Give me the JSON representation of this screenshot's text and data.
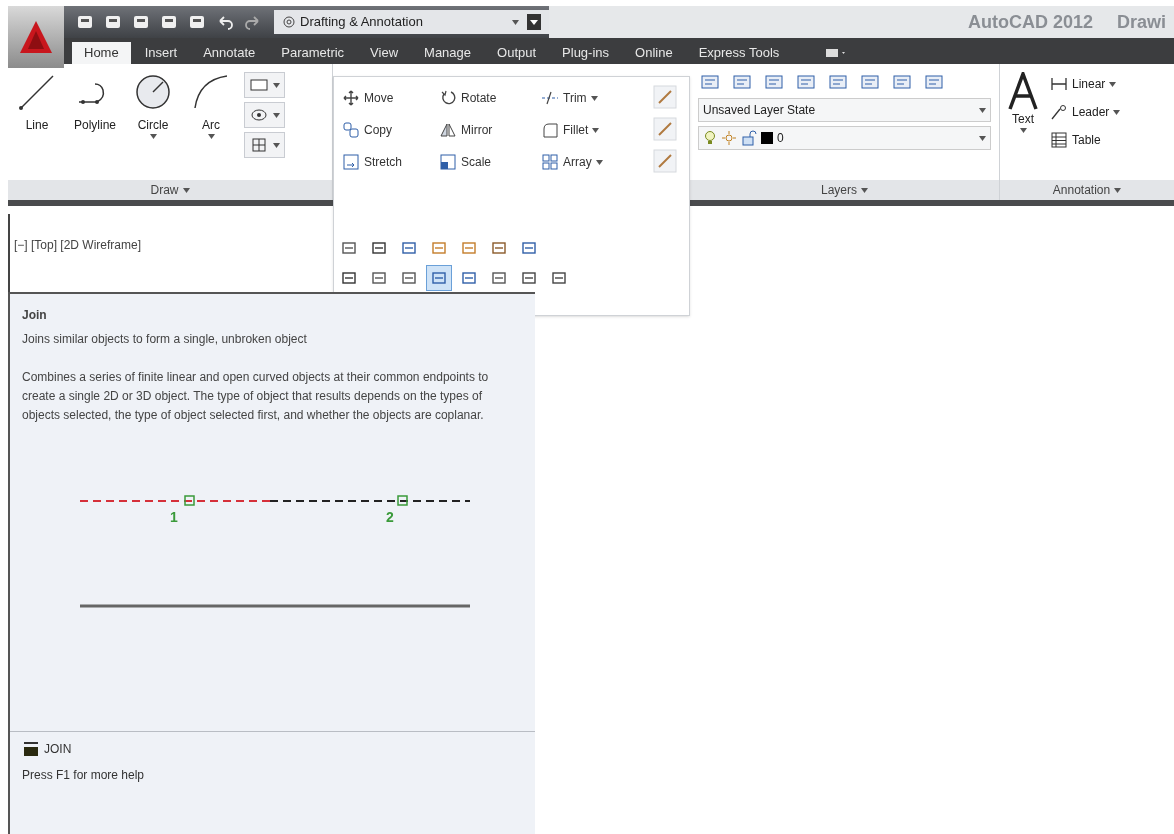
{
  "title_bar": {
    "workspace": "Drafting & Annotation",
    "app_title": "AutoCAD 2012",
    "document_title": "Drawi"
  },
  "tabs": [
    {
      "label": "Home",
      "selected": true
    },
    {
      "label": "Insert",
      "selected": false
    },
    {
      "label": "Annotate",
      "selected": false
    },
    {
      "label": "Parametric",
      "selected": false
    },
    {
      "label": "View",
      "selected": false
    },
    {
      "label": "Manage",
      "selected": false
    },
    {
      "label": "Output",
      "selected": false
    },
    {
      "label": "Plug-ins",
      "selected": false
    },
    {
      "label": "Online",
      "selected": false
    },
    {
      "label": "Express Tools",
      "selected": false
    }
  ],
  "draw_panel": {
    "label": "Draw",
    "tools": [
      {
        "kind": "line",
        "label": "Line",
        "dropdown": false
      },
      {
        "kind": "polyline",
        "label": "Polyline",
        "dropdown": false
      },
      {
        "kind": "circle",
        "label": "Circle",
        "dropdown": true
      },
      {
        "kind": "arc",
        "label": "Arc",
        "dropdown": true
      }
    ]
  },
  "modify_panel": {
    "tools": [
      {
        "kind": "move",
        "label": "Move",
        "dropdown": false
      },
      {
        "kind": "rotate",
        "label": "Rotate",
        "dropdown": false
      },
      {
        "kind": "trim",
        "label": "Trim",
        "dropdown": true
      },
      {
        "kind": "copy",
        "label": "Copy",
        "dropdown": false
      },
      {
        "kind": "mirror",
        "label": "Mirror",
        "dropdown": false
      },
      {
        "kind": "fillet",
        "label": "Fillet",
        "dropdown": true
      },
      {
        "kind": "stretch",
        "label": "Stretch",
        "dropdown": false
      },
      {
        "kind": "scale",
        "label": "Scale",
        "dropdown": false
      },
      {
        "kind": "array",
        "label": "Array",
        "dropdown": true
      }
    ],
    "expanded_tools": [
      {
        "selected": false
      },
      {
        "selected": false
      },
      {
        "selected": false
      },
      {
        "selected": false
      },
      {
        "selected": false
      },
      {
        "selected": false
      },
      {
        "selected": false
      },
      {
        "selected": false
      },
      {
        "selected": false
      },
      {
        "selected": false
      },
      {
        "selected": true
      },
      {
        "selected": false
      },
      {
        "selected": false
      },
      {
        "selected": false
      },
      {
        "selected": false
      }
    ]
  },
  "layers_panel": {
    "label": "Layers",
    "layer_state": "Unsaved Layer State",
    "current_layer": "0"
  },
  "annotation_panel": {
    "label": "Annotation",
    "text_tool": "Text",
    "tools": [
      {
        "kind": "linear",
        "label": "Linear"
      },
      {
        "kind": "leader",
        "label": "Leader"
      },
      {
        "kind": "table",
        "label": "Table"
      }
    ]
  },
  "viewport": {
    "label": "[−] [Top] [2D Wireframe]"
  },
  "tooltip": {
    "title": "Join",
    "summary": "Joins similar objects to form a single, unbroken object",
    "description": "Combines a series of finite linear and open curved objects at their common endpoints to create a single 2D or 3D object. The type of object that results depends on the types of objects selected, the type of object selected first, and whether the objects are coplanar.",
    "pick_labels": [
      "1",
      "2"
    ],
    "command": "JOIN",
    "help": "Press F1 for more help"
  }
}
